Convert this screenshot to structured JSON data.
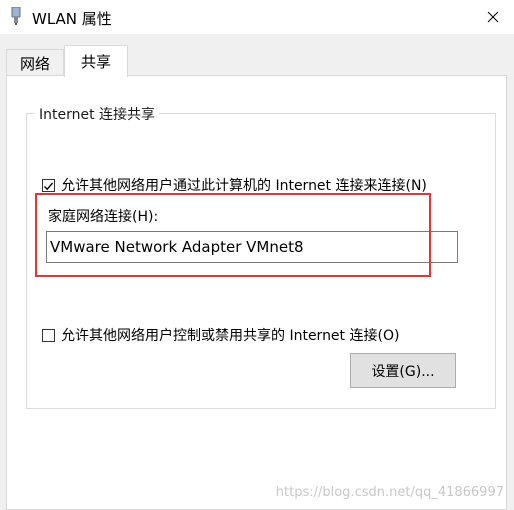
{
  "window": {
    "title": "WLAN 属性",
    "icon": "network-adapter-icon",
    "close_icon": "close-icon"
  },
  "tabs": [
    {
      "label": "网络",
      "selected": false
    },
    {
      "label": "共享",
      "selected": true
    }
  ],
  "sharing": {
    "group_title": "Internet 连接共享",
    "allow_connect_label": "允许其他网络用户通过此计算机的 Internet 连接来连接(N)",
    "allow_connect_checked": true,
    "home_network_label": "家庭网络连接(H):",
    "home_network_value": "VMware Network Adapter VMnet8",
    "allow_control_label": "允许其他网络用户控制或禁用共享的 Internet 连接(O)",
    "allow_control_checked": false,
    "settings_button": "设置(G)..."
  },
  "watermark": "https://blog.csdn.net/qq_41866997",
  "colors": {
    "highlight": "#e0373b",
    "client_bg": "#f0f0f0",
    "button_bg": "#e1e1e1"
  }
}
